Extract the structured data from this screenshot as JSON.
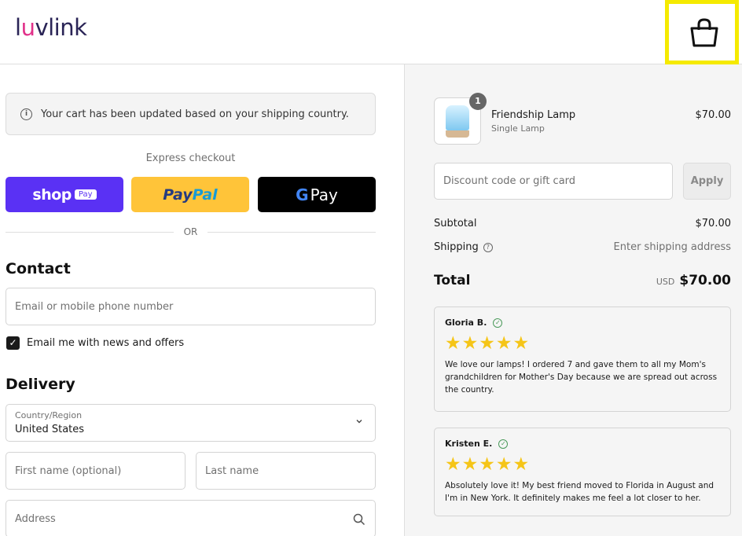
{
  "header": {
    "logo_pre": "l",
    "logo_u": "u",
    "logo_post": "vlink"
  },
  "notice": {
    "text": "Your cart has been updated based on your shipping country."
  },
  "express": {
    "title": "Express checkout",
    "shop_word": "shop",
    "shop_pill": "Pay",
    "paypal_a": "Pay",
    "paypal_b": "Pal",
    "gpay_g": "G",
    "gpay_text": "Pay",
    "or": "OR"
  },
  "contact": {
    "heading": "Contact",
    "email_placeholder": "Email or mobile phone number",
    "newsletter_label": "Email me with news and offers",
    "newsletter_checked": "✓"
  },
  "delivery": {
    "heading": "Delivery",
    "country_label": "Country/Region",
    "country_value": "United States",
    "first_name_placeholder": "First name (optional)",
    "last_name_placeholder": "Last name",
    "address_placeholder": "Address"
  },
  "order": {
    "item": {
      "name": "Friendship Lamp",
      "variant": "Single Lamp",
      "price": "$70.00",
      "quantity": "1"
    },
    "discount_placeholder": "Discount code or gift card",
    "apply_label": "Apply",
    "subtotal_label": "Subtotal",
    "subtotal_value": "$70.00",
    "shipping_label": "Shipping",
    "shipping_value": "Enter shipping address",
    "total_label": "Total",
    "currency": "USD",
    "total_value": "$70.00"
  },
  "reviews": [
    {
      "name": "Gloria B.",
      "stars": "★★★★★",
      "rating": 5,
      "text": "We love our lamps! I ordered 7 and gave them to all my Mom's grandchildren for Mother's Day because we are spread out across the country."
    },
    {
      "name": "Kristen E.",
      "stars": "★★★★★",
      "rating": 5,
      "text": "Absolutely love it! My best friend moved to Florida in August and I'm in New York. It definitely makes me feel a lot closer to her."
    }
  ],
  "colors": {
    "shop_pay": "#5a31f4",
    "paypal": "#ffc439",
    "gpay": "#000000",
    "star": "#f5c518",
    "highlight": "#f5ea00"
  }
}
